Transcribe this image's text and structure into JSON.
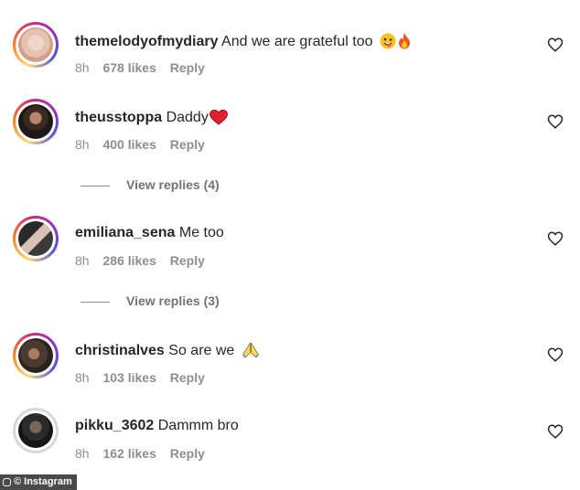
{
  "comments": [
    {
      "username": "themelodyofmydiary",
      "text": "And we are grateful too",
      "emoji": [
        "grinning-tongue",
        "fire"
      ],
      "time": "8h",
      "likes": "678 likes",
      "reply": "Reply"
    },
    {
      "username": "theusstoppa",
      "text": "Daddy",
      "emoji": [
        "red-heart"
      ],
      "time": "8h",
      "likes": "400 likes",
      "reply": "Reply",
      "view_replies": "View replies (4)"
    },
    {
      "username": "emiliana_sena",
      "text": "Me too",
      "emoji": [],
      "time": "8h",
      "likes": "286 likes",
      "reply": "Reply",
      "view_replies": "View replies (3)"
    },
    {
      "username": "christinalves",
      "text": "So are we",
      "emoji": [
        "folded-hands"
      ],
      "time": "8h",
      "likes": "103 likes",
      "reply": "Reply"
    },
    {
      "username": "pikku_3602",
      "text": "Dammm bro",
      "emoji": [],
      "time": "8h",
      "likes": "162 likes",
      "reply": "Reply"
    }
  ],
  "credit": "© Instagram",
  "colors": {
    "text": "#262626",
    "meta": "#8e8e8e",
    "story_ring": "#d62976",
    "credit_bg": "#4a4a4a"
  }
}
